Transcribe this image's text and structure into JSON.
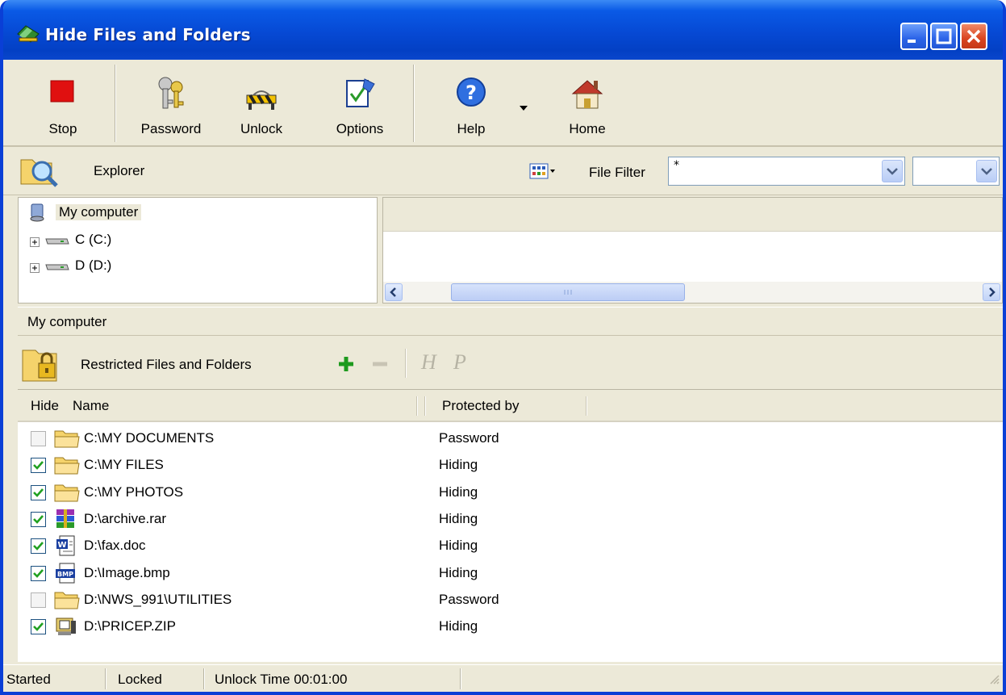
{
  "window": {
    "title": "Hide Files and Folders"
  },
  "toolbar": {
    "stop_label": "Stop",
    "password_label": "Password",
    "unlock_label": "Unlock",
    "options_label": "Options",
    "help_label": "Help",
    "home_label": "Home"
  },
  "explorer": {
    "label": "Explorer",
    "file_filter_label": "File Filter",
    "file_filter_value": "*",
    "second_combo_value": ""
  },
  "tree": {
    "root": "My computer",
    "drives": [
      "C (C:)",
      "D (D:)"
    ]
  },
  "path_bar": {
    "text": "My computer"
  },
  "restricted": {
    "label": "Restricted Files and Folders",
    "h_label": "H",
    "p_label": "P"
  },
  "list": {
    "columns": {
      "hide": "Hide",
      "name": "Name",
      "protected_by": "Protected by"
    },
    "rows": [
      {
        "checked": false,
        "icon": "folder-icon",
        "name": "C:\\MY DOCUMENTS",
        "protected_by": "Password"
      },
      {
        "checked": true,
        "icon": "folder-icon",
        "name": "C:\\MY FILES",
        "protected_by": "Hiding"
      },
      {
        "checked": true,
        "icon": "folder-icon",
        "name": "C:\\MY PHOTOS",
        "protected_by": "Hiding"
      },
      {
        "checked": true,
        "icon": "rar-archive-icon",
        "name": "D:\\archive.rar",
        "protected_by": "Hiding"
      },
      {
        "checked": true,
        "icon": "word-document-icon",
        "name": "D:\\fax.doc",
        "protected_by": "Hiding"
      },
      {
        "checked": true,
        "icon": "bmp-image-icon",
        "name": "D:\\Image.bmp",
        "protected_by": "Hiding"
      },
      {
        "checked": false,
        "icon": "folder-icon",
        "name": "D:\\NWS_991\\UTILITIES",
        "protected_by": "Password"
      },
      {
        "checked": true,
        "icon": "zip-archive-icon",
        "name": "D:\\PRICEP.ZIP",
        "protected_by": "Hiding"
      }
    ]
  },
  "status": {
    "state": "Started",
    "lock": "Locked",
    "unlock_time": "Unlock Time 00:01:00"
  },
  "colors": {
    "titlebar": "#0649d4",
    "chrome": "#ece9d8",
    "stop_red": "#e01010",
    "add_green": "#1e9a1e"
  }
}
